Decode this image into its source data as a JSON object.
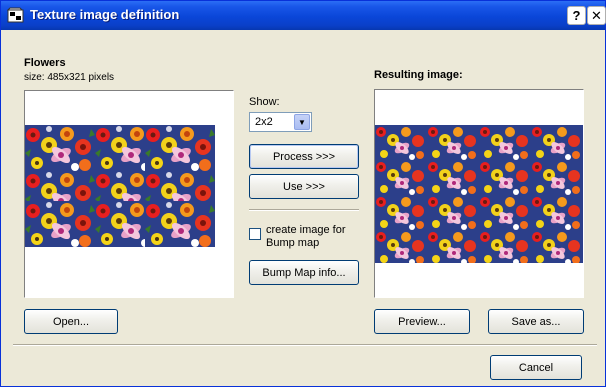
{
  "window": {
    "title": "Texture image definition",
    "help_label": "?",
    "close_label": "✕"
  },
  "source": {
    "name": "Flowers",
    "size_text": "size: 485x321 pixels",
    "open_label": "Open..."
  },
  "controls": {
    "show_label": "Show:",
    "show_value": "2x2",
    "process_label": "Process >>>",
    "use_label": "Use >>>",
    "bump_checkbox_label_line1": "create image for",
    "bump_checkbox_label_line2": "Bump map",
    "bump_checked": false,
    "bump_info_label": "Bump Map info..."
  },
  "result": {
    "heading": "Resulting image:",
    "preview_label": "Preview...",
    "save_label": "Save as..."
  },
  "footer": {
    "cancel_label": "Cancel"
  },
  "colors": {
    "title_bar": "#0a46d8",
    "dialog_bg": "#ece9d8",
    "flower_bg": "#2c3f8a"
  }
}
